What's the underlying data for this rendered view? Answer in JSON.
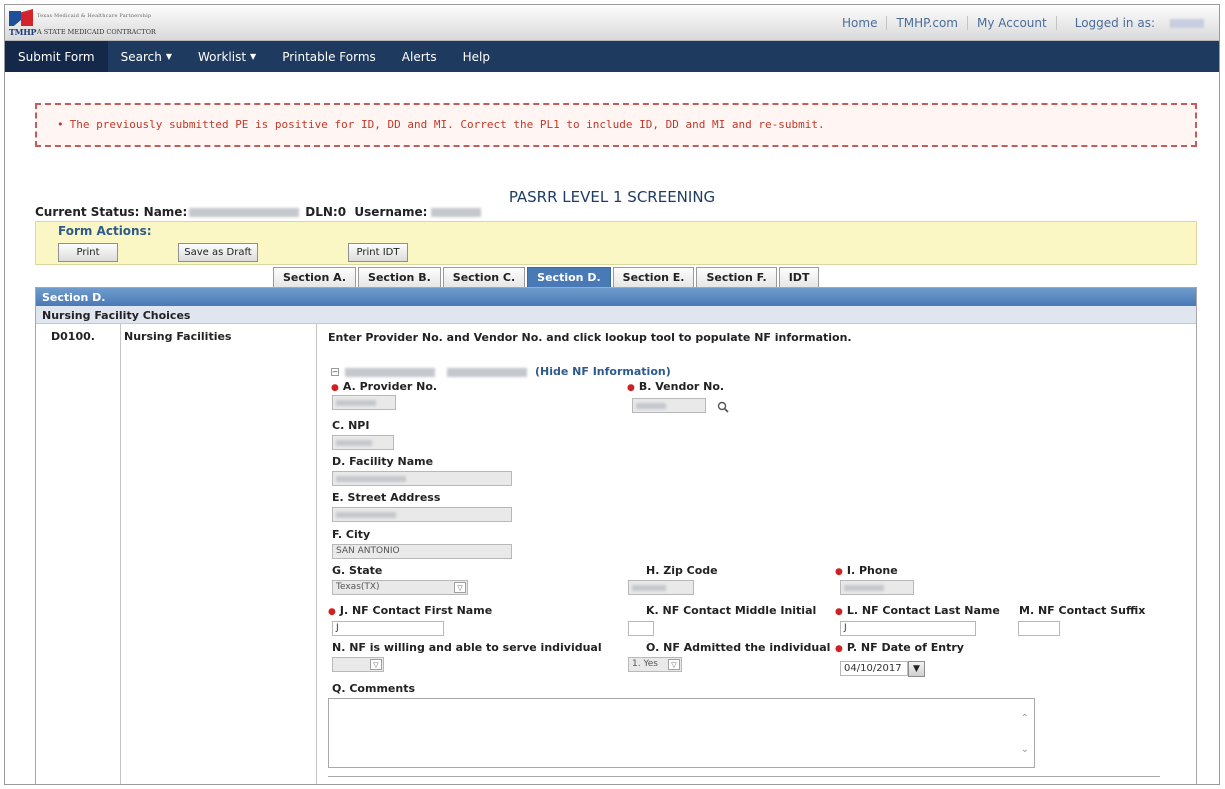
{
  "header": {
    "logo_line1": "Texas Medicaid & Healthcare Partnership",
    "logo_line2": "A STATE MEDICAID CONTRACTOR",
    "logo_tm": "TMHP",
    "links": [
      "Home",
      "TMHP.com",
      "My Account"
    ],
    "logged_in_label": "Logged in as:"
  },
  "nav": {
    "items": [
      {
        "label": "Submit Form",
        "caret": ""
      },
      {
        "label": "Search",
        "caret": "▼"
      },
      {
        "label": "Worklist",
        "caret": "▼"
      },
      {
        "label": "Printable Forms",
        "caret": ""
      },
      {
        "label": "Alerts",
        "caret": ""
      },
      {
        "label": "Help",
        "caret": ""
      }
    ]
  },
  "error": {
    "bullet": "•",
    "message": "The previously submitted PE is positive for ID, DD and MI. Correct the PL1 to include ID, DD and MI and re-submit."
  },
  "page_title": "PASRR LEVEL 1 SCREENING",
  "current_status": {
    "label": "Current Status: Name:",
    "dln": "DLN:0",
    "username_label": "Username:"
  },
  "form_actions": {
    "label": "Form Actions:",
    "print": "Print",
    "save_draft": "Save as Draft",
    "print_idt": "Print IDT"
  },
  "tabs": [
    "Section A.",
    "Section B.",
    "Section C.",
    "Section D.",
    "Section E.",
    "Section F.",
    "IDT"
  ],
  "active_tab": "Section D.",
  "section": {
    "title": "Section D.",
    "subtitle": "Nursing Facility Choices",
    "code": "D0100.",
    "row_label": "Nursing Facilities",
    "instructions": "Enter Provider No. and Vendor No. and click lookup tool to populate NF information.",
    "hide_info": "(Hide NF Information)",
    "toggle": "−"
  },
  "fields": {
    "provider_no": "A. Provider No.",
    "vendor_no": "B. Vendor No.",
    "npi": "C. NPI",
    "facility_name": "D. Facility Name",
    "street": "E. Street Address",
    "city": "F. City",
    "city_value": "SAN ANTONIO",
    "state": "G. State",
    "state_value": "Texas(TX)",
    "zip": "H. Zip Code",
    "phone": "I. Phone",
    "contact_first": "J. NF Contact First Name",
    "contact_first_value": "J",
    "contact_middle": "K. NF Contact Middle Initial",
    "contact_last": "L. NF Contact Last Name",
    "contact_last_value": "J",
    "contact_suffix": "M. NF Contact Suffix",
    "willing": "N. NF is willing and able to serve individual",
    "admitted": "O. NF Admitted the individual",
    "admitted_value": "1. Yes",
    "date_entry": "P. NF Date of Entry",
    "date_entry_value": "04/10/2017",
    "comments": "Q. Comments"
  },
  "colors": {
    "nav_bg": "#1f3a5f",
    "active_tab": "#4a7ab6",
    "error_text": "#c0392b",
    "required_dot": "#d02020"
  }
}
